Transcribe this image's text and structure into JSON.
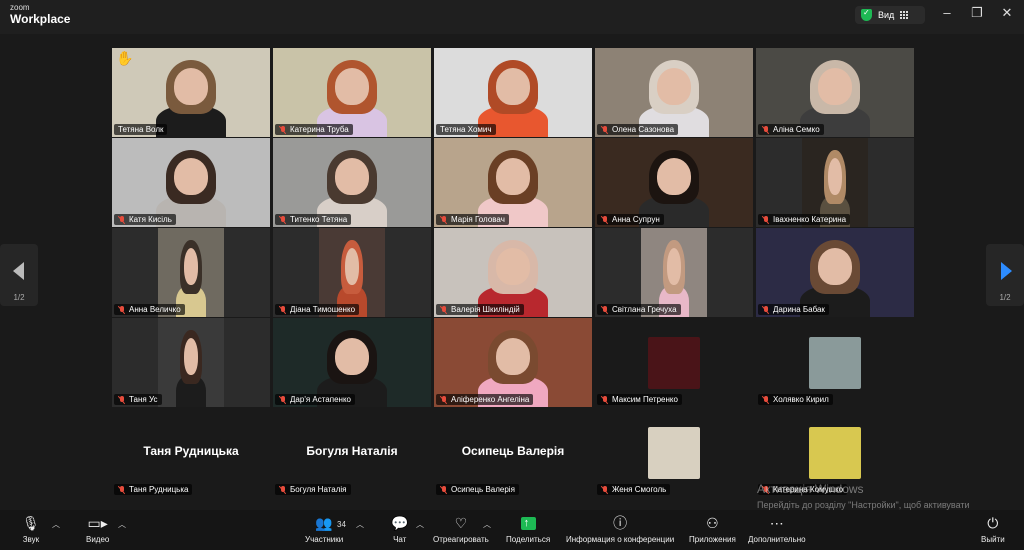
{
  "titlebar": {
    "logo_small": "zoom",
    "logo_big": "Workplace",
    "view_label": "Вид",
    "minimize": "–",
    "restore": "❐",
    "close": "✕"
  },
  "pager": {
    "left_page": "1/2",
    "right_page": "1/2"
  },
  "participants": [
    {
      "name": "Тетяна Волк",
      "hand_raised": true,
      "muted": false,
      "active": true
    },
    {
      "name": "Катерина Труба",
      "muted": true
    },
    {
      "name": "Тетяна Хомич",
      "muted": false
    },
    {
      "name": "Олена Сазонова",
      "muted": true
    },
    {
      "name": "Аліна Семко",
      "muted": true
    },
    {
      "name": "Катя Кисіль",
      "muted": true
    },
    {
      "name": "Титенко Тетяна",
      "muted": true
    },
    {
      "name": "Марія Головач",
      "muted": true
    },
    {
      "name": "Анна Супрун",
      "muted": true
    },
    {
      "name": "Івахненко Катерина",
      "muted": true
    },
    {
      "name": "Анна Величко",
      "muted": true
    },
    {
      "name": "Діана Тимошенко",
      "muted": true
    },
    {
      "name": "Валерія Шкиліндій",
      "muted": true
    },
    {
      "name": "Світлана Гречуха",
      "muted": true
    },
    {
      "name": "Дарина Бабак",
      "muted": true
    },
    {
      "name": "Таня Ус",
      "muted": true
    },
    {
      "name": "Дар'я Астапенко",
      "muted": true
    },
    {
      "name": "Аліференко Ангеліна",
      "muted": true
    },
    {
      "name": "Максим Петренко",
      "muted": true
    },
    {
      "name": "Холявко Кирил",
      "muted": true
    },
    {
      "name": "Таня Рудницька",
      "muted": true,
      "video_off": true
    },
    {
      "name": "Богуля Наталія",
      "muted": true,
      "video_off": true
    },
    {
      "name": "Осипець Валерія",
      "muted": true,
      "video_off": true
    },
    {
      "name": "Женя Смоголь",
      "muted": true
    },
    {
      "name": "Катерина Комушко",
      "muted": true
    }
  ],
  "watermark": {
    "title": "Активація Windows",
    "subtitle": "Перейдіть до розділу \"Настройки\", щоб активувати Windows."
  },
  "toolbar": {
    "audio": "Звук",
    "video": "Видео",
    "participants": "Участники",
    "participants_count": "34",
    "chat": "Чат",
    "react": "Отреагировать",
    "share": "Поделиться",
    "info": "Информация о конференции",
    "apps": "Приложения",
    "more": "Дополнительно",
    "leave": "Выйти"
  },
  "colors": {
    "active_speaker": "#4cd964",
    "accent_blue": "#2d8cff",
    "share_green": "#1db954",
    "muted_red": "#e74c3c"
  }
}
